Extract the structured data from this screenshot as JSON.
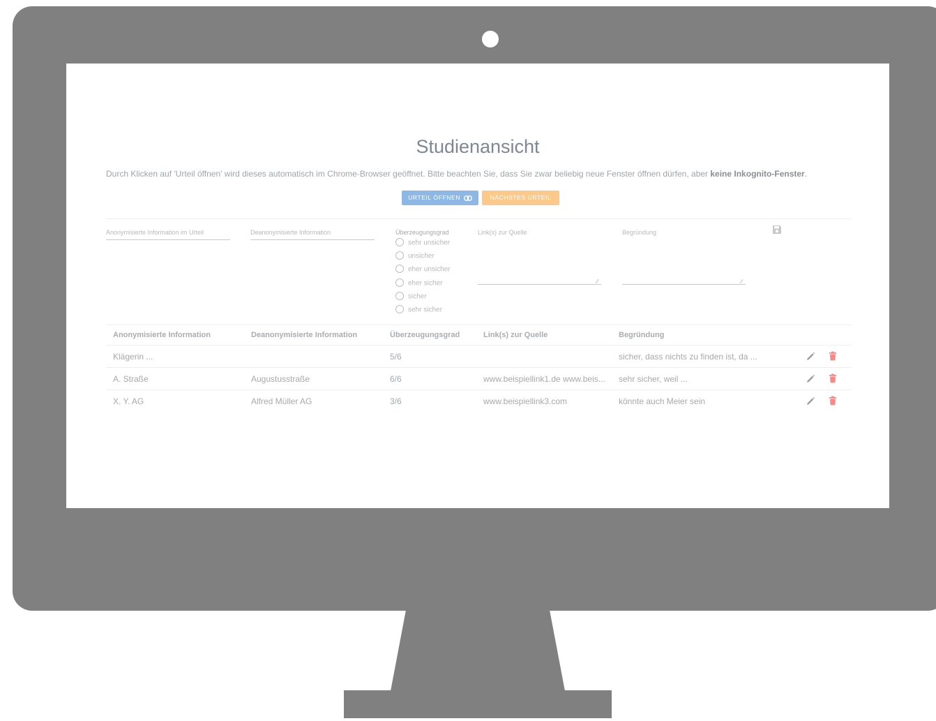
{
  "page": {
    "title": "Studienansicht",
    "description_start": "Durch Klicken auf 'Urteil öffnen' wird dieses automatisch im Chrome-Browser geöffnet. Bitte beachten Sie, dass Sie zwar beliebig neue Fenster öffnen dürfen, aber ",
    "description_bold": "keine Inkognito-Fenster",
    "description_end": ".",
    "open_button": "URTEIL ÖFFNEN",
    "next_button": "NÄCHSTES URTEIL"
  },
  "form": {
    "anon_label": "Anonymisierte Information im Urteil",
    "deanon_label": "Deanonymisierte Information",
    "confidence_label": "Überzeugungsgrad",
    "confidence_options": [
      "sehr unsicher",
      "unsicher",
      "eher unsicher",
      "eher sicher",
      "sicher",
      "sehr sicher"
    ],
    "links_label": "Link(s) zur Quelle",
    "reason_label": "Begründung"
  },
  "table": {
    "headers": [
      "Anonymisierte Information",
      "Deanonymisierte Information",
      "Überzeugungsgrad",
      "Link(s) zur Quelle",
      "Begründung"
    ],
    "rows": [
      [
        "Klägerin ...",
        "",
        "5/6",
        "",
        "sicher, dass nichts zu finden ist, da ..."
      ],
      [
        "A. Straße",
        "Augustusstraße",
        "6/6",
        "www.beispiellink1.de www.beis...",
        "sehr sicher, weil ..."
      ],
      [
        "X. Y. AG",
        "Alfred Müller AG",
        "3/6",
        "www.beispiellink3.com",
        "könnte auch Meier sein"
      ]
    ]
  },
  "colors": {
    "monitor": "#808080",
    "open_button": "#8db8e6",
    "next_button": "#fbc98a",
    "delete_icon": "#f28a8a",
    "edit_icon": "#a0a0a0"
  }
}
